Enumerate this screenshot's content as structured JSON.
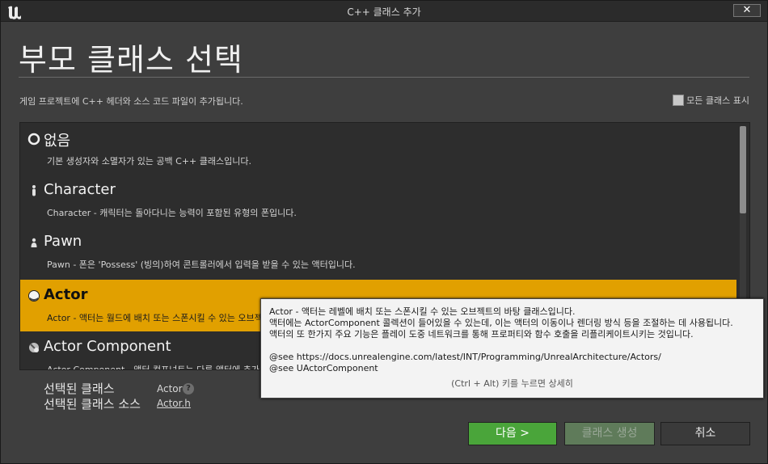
{
  "window": {
    "title": "C++ 클래스 추가",
    "close": "✕"
  },
  "header": {
    "title": "부모 클래스 선택",
    "description": "게임 프로젝트에 C++ 헤더와 소스 코드 파일이 추가됩니다.",
    "show_all_label": "모든 클래스 표시"
  },
  "class_list": [
    {
      "name": "없음",
      "description": "기본 생성자와 소멸자가 있는 공백 C++ 클래스입니다.",
      "icon": "empty-circle-icon"
    },
    {
      "name": "Character",
      "description": "Character - 캐릭터는 돌아다니는 능력이 포함된 유형의 폰입니다.",
      "icon": "character-icon"
    },
    {
      "name": "Pawn",
      "description": "Pawn - 폰은 'Possess' (빙의)하여 콘트롤러에서 입력을 받을 수 있는 액터입니다.",
      "icon": "pawn-icon"
    },
    {
      "name": "Actor",
      "description": "Actor - 액터는 월드에 배치 또는 스폰시킬 수 있는 오브젝트입니다.",
      "icon": "actor-icon",
      "selected": true
    },
    {
      "name": "Actor Component",
      "description": "Actor Component - 액터 컴포넌트는 다른 액터에 추가",
      "icon": "actor-component-icon"
    }
  ],
  "selection": {
    "class_label": "선택된 클래스",
    "class_value": "Actor",
    "source_label": "선택된 클래스 소스",
    "source_value": "Actor.h"
  },
  "buttons": {
    "next": "다음 >",
    "create": "클래스 생성",
    "cancel": "취소"
  },
  "tooltip": {
    "lines": [
      "Actor - 액터는 레벨에 배치 또는 스폰시킬 수 있는 오브젝트의 바탕 클래스입니다.",
      "액터에는 ActorComponent 콜렉션이 들어있을 수 있는데, 이는 액터의 이동이나 렌더링 방식 등을 조절하는 데 사용됩니다.",
      "액터의 또 한가지 주요 기능은 플레이 도중 네트워크를 통해 프로퍼티와 함수 호출을 리플리케이트시키는 것입니다."
    ],
    "see1": "@see https://docs.unrealengine.com/latest/INT/Programming/UnrealArchitecture/Actors/",
    "see2": "@see UActorComponent",
    "hint": "(Ctrl + Alt) 키를 누르면 상세히"
  },
  "colors": {
    "selected_row": "#e1a000",
    "next_button": "#4aa53a",
    "background": "#3e3e3e"
  }
}
